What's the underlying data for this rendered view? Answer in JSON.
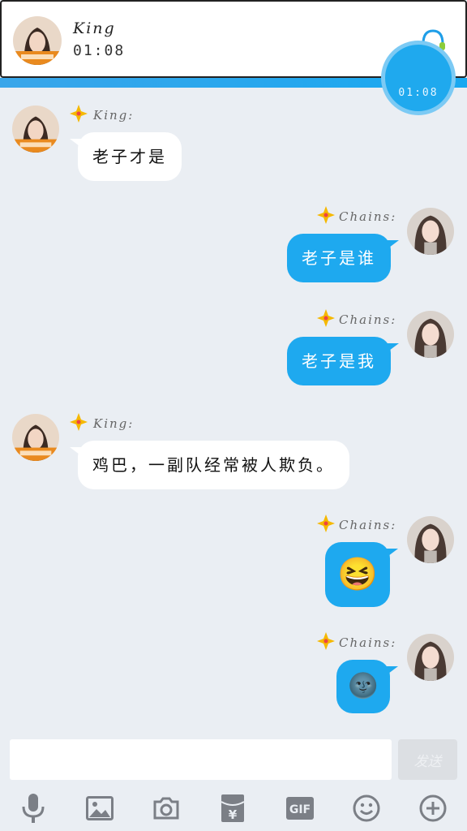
{
  "header": {
    "name": "King",
    "time": "01:08",
    "timer_bubble": "01:08"
  },
  "messages": [
    {
      "sender": "King:",
      "text": "老子才是"
    },
    {
      "sender": "Chains:",
      "text": "老子是谁"
    },
    {
      "sender": "Chains:",
      "text": "老子是我"
    },
    {
      "sender": "King:",
      "text": "鸡巴，一副队经常被人欺负。"
    },
    {
      "sender": "Chains:",
      "emoji": "😆"
    },
    {
      "sender": "Chains:",
      "emoji": "🌚"
    }
  ],
  "input": {
    "placeholder": "",
    "send_label": "发送"
  },
  "toolbar": {
    "icons": [
      "microphone-icon",
      "image-icon",
      "camera-icon",
      "red-packet-icon",
      "gif-icon",
      "emoji-icon",
      "plus-icon"
    ],
    "gif_label": "GIF",
    "yuan_label": "¥"
  },
  "colors": {
    "accent": "#1ea9ef",
    "background": "#eaeef3",
    "incoming_bubble": "#ffffff"
  }
}
